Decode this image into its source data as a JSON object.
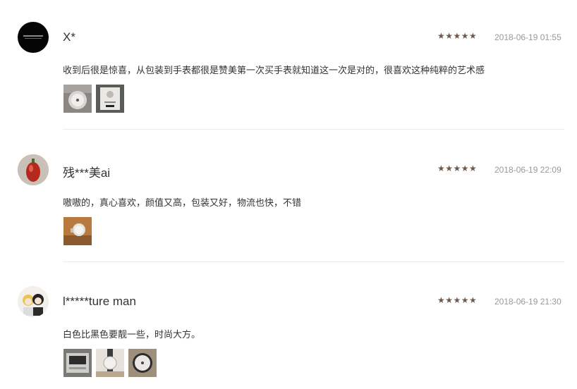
{
  "reviews": [
    {
      "user": "X*",
      "stars": "★★★★★",
      "rating": 5,
      "date": "2018-06-19 01:55",
      "text": "收到后很是惊喜，从包装到手表都很是赞美第一次买手表就知道这一次是对的，很喜欢这种纯粹的艺术感",
      "avatar_icon": "black-logo-avatar-icon",
      "photos": [
        "watch-photo-icon",
        "watch-box-photo-icon"
      ]
    },
    {
      "user": "残***美ai",
      "stars": "★★★★★",
      "rating": 5,
      "date": "2018-06-19 22:09",
      "text": "嗷嗷的，真心喜欢，颜值又高，包装又好，物流也快，不错",
      "avatar_icon": "red-fruit-avatar-icon",
      "photos": [
        "wrist-watch-photo-icon"
      ]
    },
    {
      "user": "l*****ture man",
      "stars": "★★★★★",
      "rating": 5,
      "date": "2018-06-19 21:30",
      "text": "白色比黑色要靓一些，时尚大方。",
      "avatar_icon": "cartoon-couple-avatar-icon",
      "photos": [
        "watch-box-photo-icon",
        "watch-strap-photo-icon",
        "watch-face-photo-icon"
      ]
    }
  ]
}
